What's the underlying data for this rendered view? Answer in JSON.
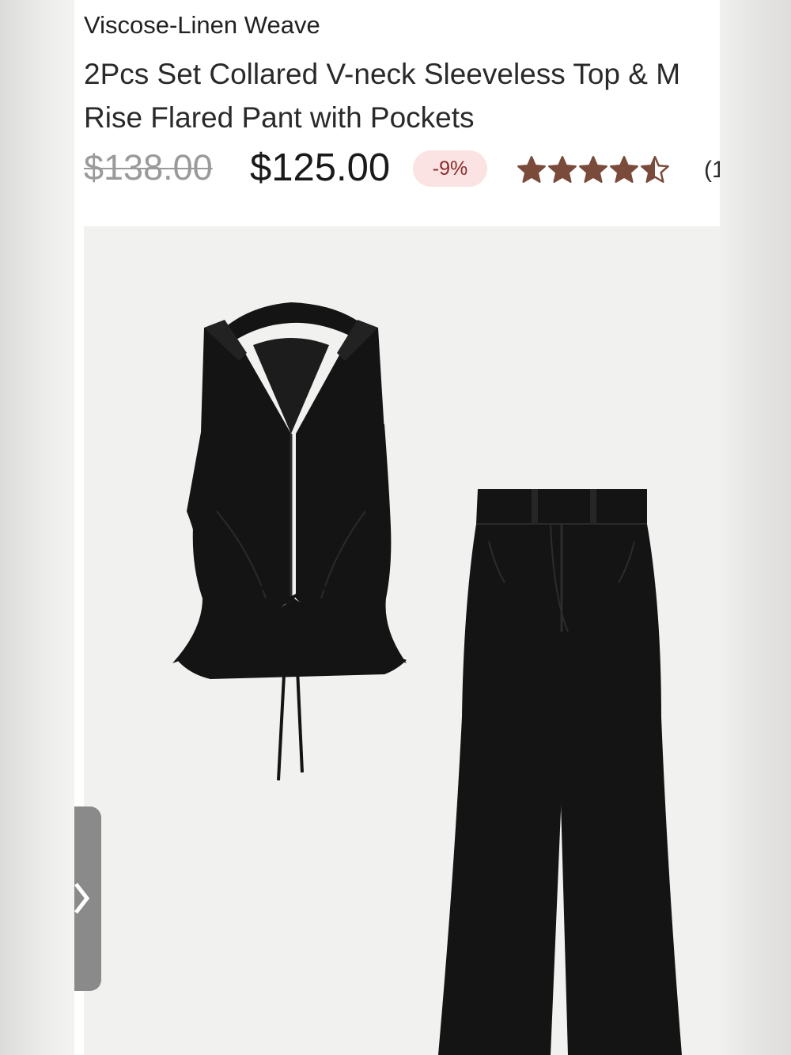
{
  "product": {
    "category": "Viscose-Linen Weave",
    "title_line1": "2Pcs Set Collared V-neck Sleeveless Top & M",
    "title_line2": "Rise Flared Pant with Pockets",
    "original_price": "$138.00",
    "sale_price": "$125.00",
    "discount": "-9%",
    "rating": 4.5,
    "rating_max": 5,
    "review_count": "(1"
  },
  "colors": {
    "star": "#7a4a3a",
    "discount_bg": "#fbe3e3",
    "discount_text": "#8a2a2a",
    "garment": "#141414",
    "image_bg": "#f1f1ef"
  },
  "icons": {
    "rating": "star-icon",
    "nav": "chevron-right-icon"
  }
}
